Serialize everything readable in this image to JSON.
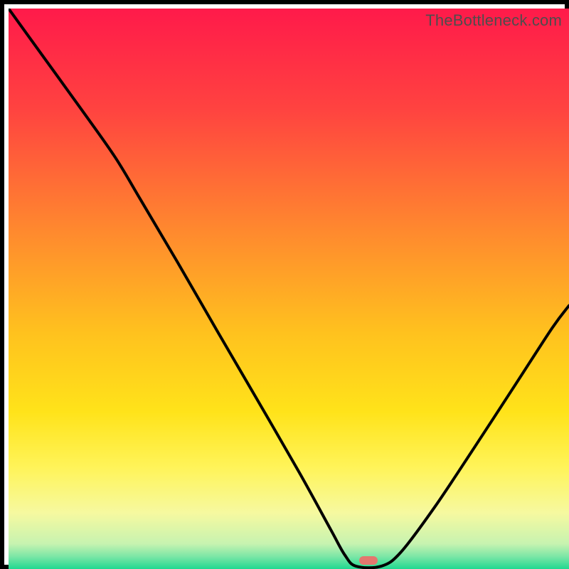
{
  "watermark": "TheBottleneck.com",
  "marker": {
    "color": "#e3776e",
    "x_frac": 0.642,
    "y_frac": 0.985
  },
  "gradient_stops": [
    {
      "offset": 0.0,
      "color": "#ff1a4a"
    },
    {
      "offset": 0.18,
      "color": "#ff4340"
    },
    {
      "offset": 0.4,
      "color": "#ff8a2e"
    },
    {
      "offset": 0.58,
      "color": "#ffc21e"
    },
    {
      "offset": 0.72,
      "color": "#ffe31a"
    },
    {
      "offset": 0.82,
      "color": "#fff45a"
    },
    {
      "offset": 0.9,
      "color": "#f6f9a0"
    },
    {
      "offset": 0.955,
      "color": "#c7f3b0"
    },
    {
      "offset": 0.978,
      "color": "#7be6a6"
    },
    {
      "offset": 1.0,
      "color": "#20d890"
    }
  ],
  "chart_data": {
    "type": "line",
    "title": "",
    "xlabel": "",
    "ylabel": "",
    "xlim": [
      0,
      1
    ],
    "ylim": [
      0,
      1
    ],
    "series": [
      {
        "name": "curve",
        "points": [
          {
            "x": 0.0,
            "y": 1.0
          },
          {
            "x": 0.065,
            "y": 0.91
          },
          {
            "x": 0.13,
            "y": 0.82
          },
          {
            "x": 0.19,
            "y": 0.735
          },
          {
            "x": 0.235,
            "y": 0.66
          },
          {
            "x": 0.3,
            "y": 0.55
          },
          {
            "x": 0.375,
            "y": 0.42
          },
          {
            "x": 0.445,
            "y": 0.3
          },
          {
            "x": 0.52,
            "y": 0.17
          },
          {
            "x": 0.575,
            "y": 0.07
          },
          {
            "x": 0.6,
            "y": 0.025
          },
          {
            "x": 0.62,
            "y": 0.005
          },
          {
            "x": 0.665,
            "y": 0.005
          },
          {
            "x": 0.7,
            "y": 0.03
          },
          {
            "x": 0.76,
            "y": 0.11
          },
          {
            "x": 0.83,
            "y": 0.215
          },
          {
            "x": 0.905,
            "y": 0.33
          },
          {
            "x": 0.97,
            "y": 0.43
          },
          {
            "x": 1.0,
            "y": 0.47
          }
        ]
      }
    ],
    "annotations": [
      {
        "type": "marker",
        "x": 0.642,
        "y": 0.0
      }
    ]
  }
}
